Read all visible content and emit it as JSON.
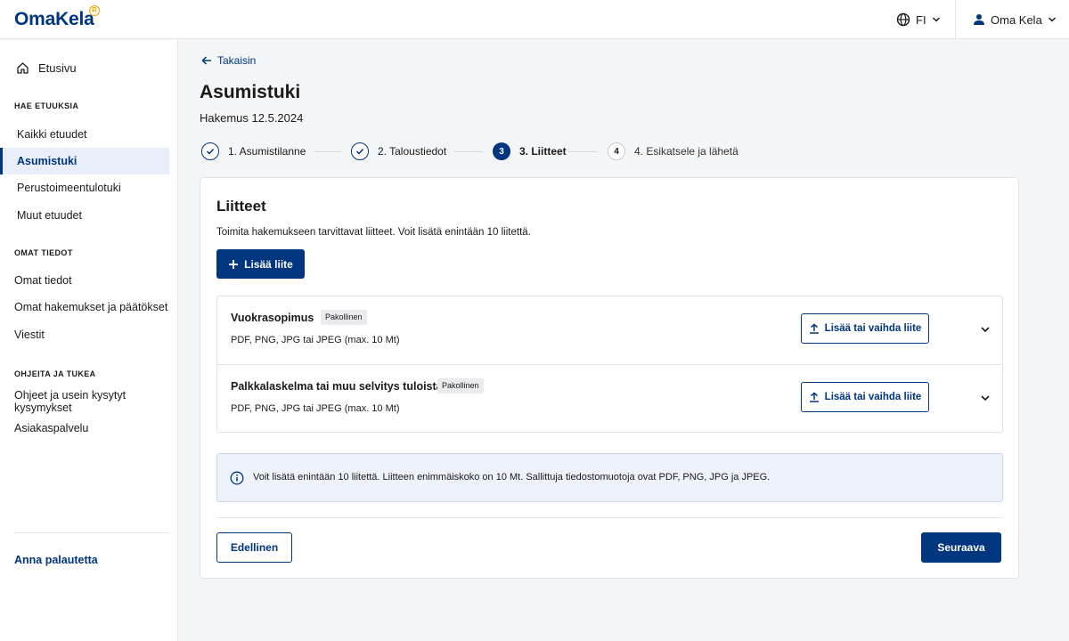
{
  "header": {
    "logo": "OmaKela",
    "logo_mark": "R",
    "language": "FI",
    "user_name": "Oma Kela"
  },
  "sidebar": {
    "home": "Etusivu",
    "sections": [
      {
        "heading": "HAE ETUUKSIA",
        "items": [
          "Kaikki etuudet",
          "Asumistuki",
          "Perustoimeentulotuki",
          "Muut etuudet"
        ],
        "active": "Asumistuki"
      },
      {
        "heading": "OMAT TIEDOT",
        "items": [
          "Omat tiedot",
          "Omat hakemukset ja päätökset",
          "Viestit"
        ]
      },
      {
        "heading": "OHJEITA JA TUKEA",
        "items": [
          "Ohjeet ja usein kysytyt kysymykset",
          "Asiakaspalvelu"
        ]
      }
    ],
    "feedback": "Anna palautetta"
  },
  "main": {
    "back_label": "Takaisin",
    "title": "Asumistuki",
    "application_date": "Hakemus 12.5.2024",
    "steps": [
      {
        "label": "1. Asumistilanne",
        "status": "done",
        "marker": ""
      },
      {
        "label": "2. Taloustiedot",
        "status": "done",
        "marker": ""
      },
      {
        "label": "3. Liitteet",
        "status": "current",
        "marker": "3"
      },
      {
        "label": "4. Esikatsele ja lähetä",
        "status": "todo",
        "marker": "4"
      }
    ]
  },
  "attachments": {
    "title": "Liitteet",
    "description": "Toimita hakemukseen tarvittavat liitteet. Voit lisätä enintään 10 liitettä.",
    "add_button": "Lisää liite",
    "items": [
      {
        "name": "Vuokrasopimus",
        "badge": "Pakollinen",
        "types": "PDF, PNG, JPG tai JPEG (max. 10 Mt)",
        "button": "Lisää tai vaihda liite"
      },
      {
        "name": "Palkkalaskelma tai muu selvitys tuloista",
        "badge": "Pakollinen",
        "types": "PDF, PNG, JPG tai JPEG (max. 10 Mt)",
        "button": "Lisää tai vaihda liite"
      }
    ],
    "info": "Voit lisätä enintään 10 liitettä. Liitteen enimmäiskoko on 10 Mt. Sallittuja tiedostomuotoja ovat PDF, PNG, JPG ja JPEG."
  },
  "navigation": {
    "previous": "Edellinen",
    "next": "Seuraava"
  },
  "icons": [
    "globe-icon",
    "chevron-down-icon",
    "user-icon",
    "home-icon",
    "arrow-left-icon",
    "check-icon",
    "plus-icon",
    "upload-icon",
    "info-icon"
  ],
  "colors": {
    "brand": "#003580",
    "logo_accent": "#f0a500",
    "active_bg": "#e8effa",
    "info_bg": "#eef3fb"
  }
}
